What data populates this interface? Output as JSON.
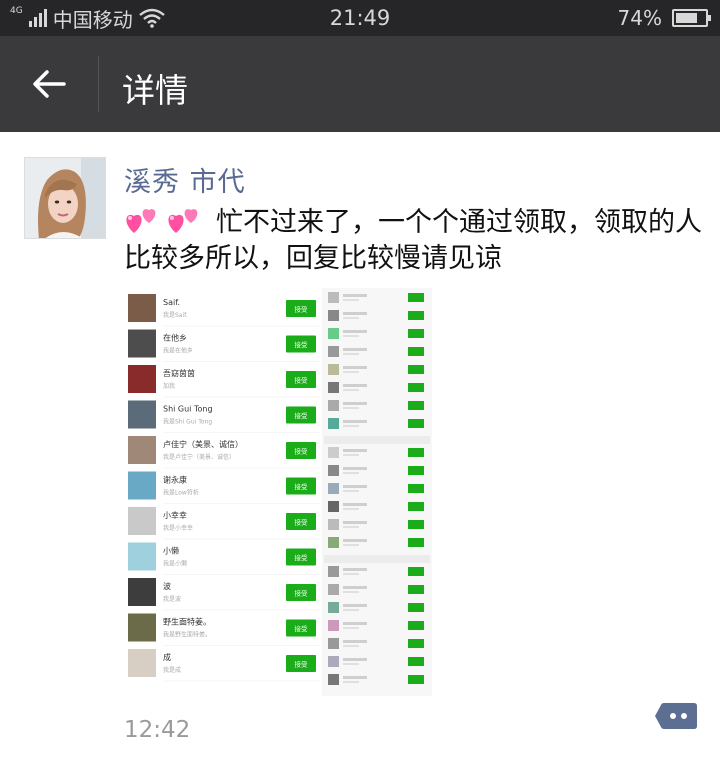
{
  "status_bar": {
    "network": "4G",
    "carrier": "中国移动",
    "time": "21:49",
    "battery_percent_text": "74%",
    "battery_level": 0.74
  },
  "nav": {
    "title": "详情",
    "back_icon": "back-arrow-icon"
  },
  "post": {
    "author": "溪秀 市代",
    "emoji": [
      "two-hearts-emoji",
      "two-hearts-emoji"
    ],
    "text": "忙不过来了，一个个通过领取，领取的人比较多所以，回复比较慢请见谅",
    "time": "12:42",
    "comment_icon": "comment-dots-icon"
  },
  "screenshot": {
    "button_label": "接受",
    "left_list": [
      {
        "name": "Saif.",
        "sub": "我是Saif."
      },
      {
        "name": "在他乡",
        "sub": "我是在他乡"
      },
      {
        "name": "吾窈茵茵",
        "sub": "加我"
      },
      {
        "name": "Shi Gui Tong",
        "sub": "我是Shi Gui Tong"
      },
      {
        "name": "卢佳宁（美景、诚信）",
        "sub": "我是卢佳宁（美景、诚信）"
      },
      {
        "name": "谢永康",
        "sub": "我是Low符析"
      },
      {
        "name": "小幸幸",
        "sub": "我是小幸幸"
      },
      {
        "name": "小懒",
        "sub": "我是小懒"
      },
      {
        "name": "波",
        "sub": "我是波"
      },
      {
        "name": "野生面特姜。",
        "sub": "我是野生面特姜。"
      },
      {
        "name": "成",
        "sub": "我是成"
      }
    ]
  },
  "colors": {
    "status_bg": "#262628",
    "nav_bg": "#3a3a3c",
    "author": "#5a6b93",
    "accept_green": "#1aad19"
  }
}
